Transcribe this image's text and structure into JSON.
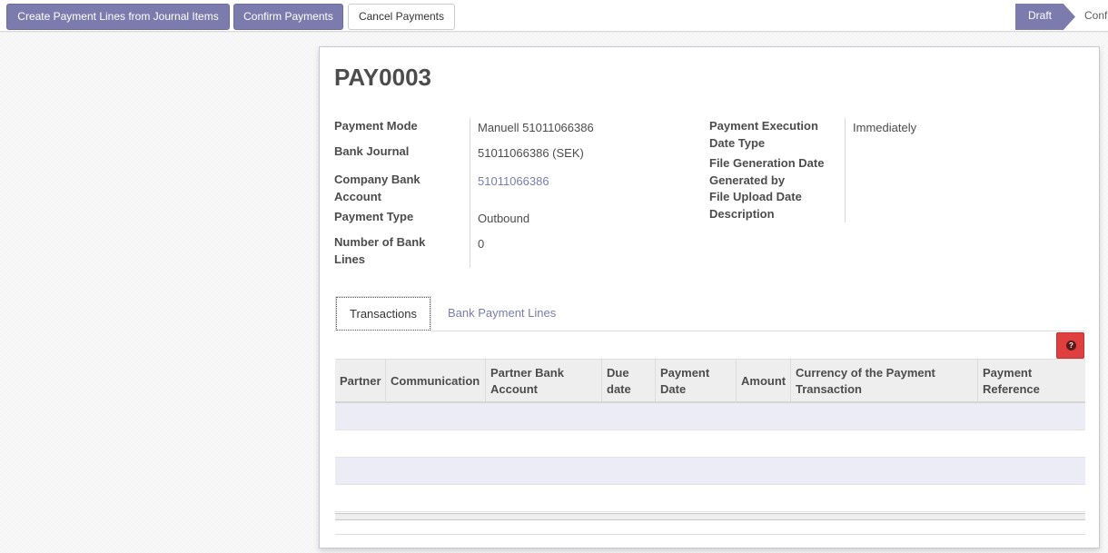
{
  "toolbar": {
    "create_lines_label": "Create Payment Lines from Journal Items",
    "confirm_label": "Confirm Payments",
    "cancel_label": "Cancel Payments"
  },
  "stages": {
    "draft": "Draft",
    "confirmed": "Confirmed",
    "active": "draft"
  },
  "record": {
    "name": "PAY0003"
  },
  "left_fields": {
    "payment_mode": {
      "label": "Payment Mode",
      "value": "Manuell 51011066386"
    },
    "bank_journal": {
      "label": "Bank Journal",
      "value": "51011066386 (SEK)"
    },
    "company_bank_account": {
      "label_line1": "Company Bank",
      "label_line2": "Account",
      "value": "51011066386"
    },
    "payment_type": {
      "label": "Payment Type",
      "value": "Outbound"
    },
    "number_bank_lines": {
      "label_line1": "Number of Bank",
      "label_line2": "Lines",
      "value": "0"
    }
  },
  "right_fields": {
    "execution_date_type": {
      "label_line1": "Payment Execution",
      "label_line2": "Date Type",
      "value": "Immediately"
    },
    "file_generation_date": {
      "label": "File Generation Date",
      "value": ""
    },
    "generated_by": {
      "label": "Generated by",
      "value": ""
    },
    "file_upload_date": {
      "label": "File Upload Date",
      "value": ""
    },
    "description": {
      "label": "Description",
      "value": ""
    }
  },
  "tabs": {
    "transactions": "Transactions",
    "bank_payment_lines": "Bank Payment Lines",
    "active": "transactions"
  },
  "help_icon": "question-circle-icon",
  "table": {
    "columns": [
      {
        "line1": "Partner",
        "line2": ""
      },
      {
        "line1": "Communication",
        "line2": ""
      },
      {
        "line1": "Partner Bank",
        "line2": "Account"
      },
      {
        "line1": "Due",
        "line2": "date"
      },
      {
        "line1": "Payment",
        "line2": "Date"
      },
      {
        "line1": "Amount",
        "line2": ""
      },
      {
        "line1": "Currency of the Payment",
        "line2": "Transaction"
      },
      {
        "line1": "Payment",
        "line2": "Reference"
      }
    ],
    "rows": []
  },
  "colors": {
    "primary": "#7c7bad",
    "help_button": "#e03f3f",
    "stripe": "#ececf6"
  }
}
